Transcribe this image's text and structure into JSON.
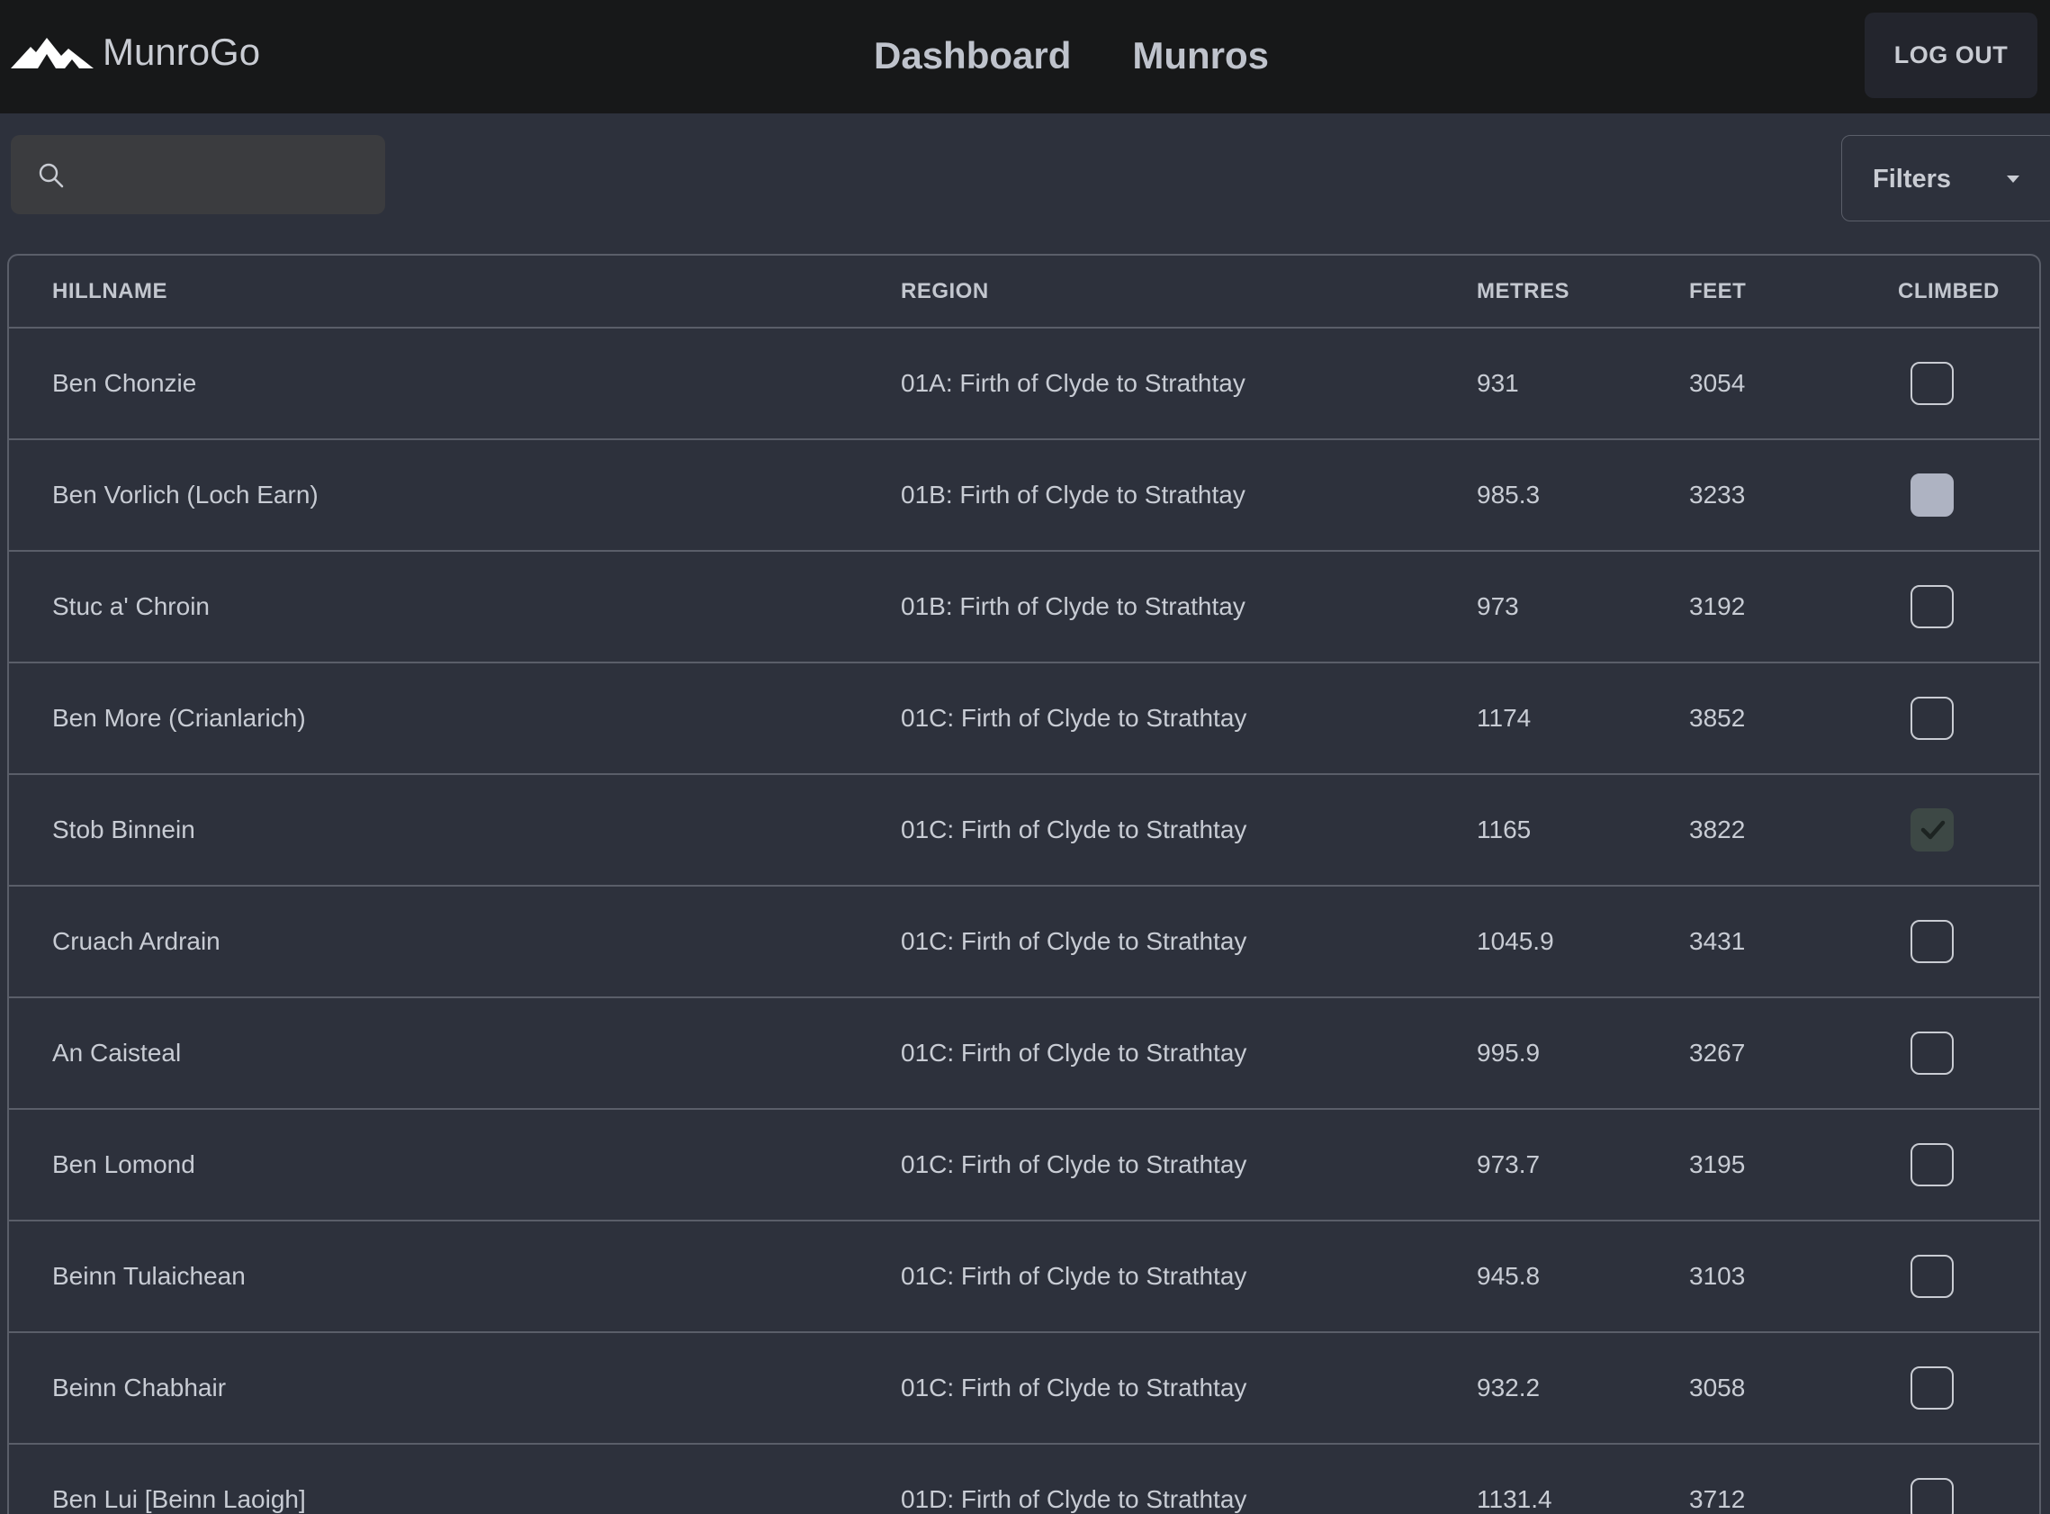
{
  "app": {
    "name": "MunroGo"
  },
  "nav": {
    "links": [
      "Dashboard",
      "Munros"
    ],
    "logout_label": "LOG OUT"
  },
  "search": {
    "placeholder": "",
    "value": ""
  },
  "filters": {
    "label": "Filters"
  },
  "table": {
    "columns": [
      "HILLNAME",
      "REGION",
      "METRES",
      "FEET",
      "CLIMBED"
    ],
    "rows": [
      {
        "name": "Ben Chonzie",
        "region": "01A: Firth of Clyde to Strathtay",
        "metres": "931",
        "feet": "3054",
        "climbed": "unchecked"
      },
      {
        "name": "Ben Vorlich (Loch Earn)",
        "region": "01B: Firth of Clyde to Strathtay",
        "metres": "985.3",
        "feet": "3233",
        "climbed": "partial"
      },
      {
        "name": "Stuc a' Chroin",
        "region": "01B: Firth of Clyde to Strathtay",
        "metres": "973",
        "feet": "3192",
        "climbed": "unchecked"
      },
      {
        "name": "Ben More (Crianlarich)",
        "region": "01C: Firth of Clyde to Strathtay",
        "metres": "1174",
        "feet": "3852",
        "climbed": "unchecked"
      },
      {
        "name": "Stob Binnein",
        "region": "01C: Firth of Clyde to Strathtay",
        "metres": "1165",
        "feet": "3822",
        "climbed": "checked"
      },
      {
        "name": "Cruach Ardrain",
        "region": "01C: Firth of Clyde to Strathtay",
        "metres": "1045.9",
        "feet": "3431",
        "climbed": "unchecked"
      },
      {
        "name": "An Caisteal",
        "region": "01C: Firth of Clyde to Strathtay",
        "metres": "995.9",
        "feet": "3267",
        "climbed": "unchecked"
      },
      {
        "name": "Ben Lomond",
        "region": "01C: Firth of Clyde to Strathtay",
        "metres": "973.7",
        "feet": "3195",
        "climbed": "unchecked"
      },
      {
        "name": "Beinn Tulaichean",
        "region": "01C: Firth of Clyde to Strathtay",
        "metres": "945.8",
        "feet": "3103",
        "climbed": "unchecked"
      },
      {
        "name": "Beinn Chabhair",
        "region": "01C: Firth of Clyde to Strathtay",
        "metres": "932.2",
        "feet": "3058",
        "climbed": "unchecked"
      },
      {
        "name": "Ben Lui [Beinn Laoigh]",
        "region": "01D: Firth of Clyde to Strathtay",
        "metres": "1131.4",
        "feet": "3712",
        "climbed": "unchecked"
      }
    ]
  },
  "colors": {
    "topbar": "#171819",
    "background": "#2d313c",
    "partial_fill": "#aeb3c2",
    "checked_fill": "#3d4845"
  }
}
